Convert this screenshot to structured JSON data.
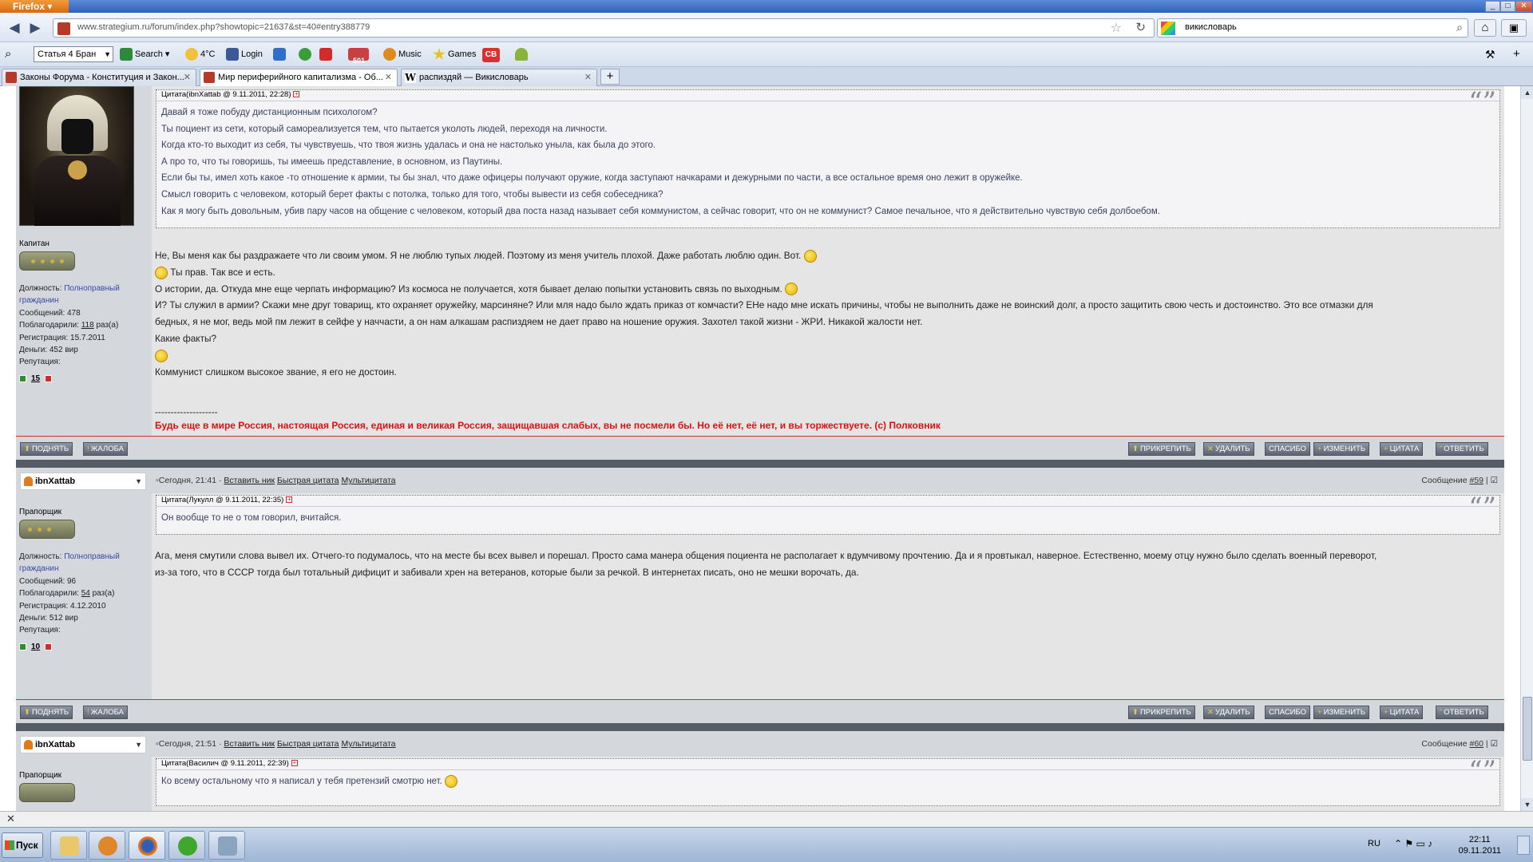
{
  "window": {
    "app_button": "Firefox"
  },
  "nav": {
    "url": "www.strategium.ru/forum/index.php?showtopic=21637&st=40#entry388779",
    "search_value": "викисловарь"
  },
  "toolbar": {
    "select_value": "Статья 4 Бран",
    "search_label": "Search",
    "weather": "4°C",
    "login_label": "Login",
    "badge_count": "501",
    "music_label": "Music",
    "games_label": "Games",
    "cb_label": "CB"
  },
  "tabs": [
    {
      "title": "Законы Форума - Конституция и Закон..."
    },
    {
      "title": "Мир периферийного капитализма - Об..."
    },
    {
      "title": "распиздяй — Викисловарь"
    }
  ],
  "posts": [
    {
      "user": {
        "rank": "Капитан",
        "position_label": "Должность:",
        "position_value": "Полноправный гражданин",
        "messages": "Сообщений: 478",
        "thanks_prefix": "Поблагодарили:",
        "thanks_count": "118",
        "thanks_suffix": "раз(а)",
        "registered": "Регистрация: 15.7.2011",
        "money": "Деньги: 452 вир",
        "rep_label": "Репутация:",
        "rep_value": "15"
      },
      "quote": {
        "title": "Цитата(ibnXattab @ 9.11.2011, 22:28)",
        "lines": [
          "Давай я тоже побуду дистанционным психологом?",
          "Ты поциент из сети, который самореализуется тем, что пытается уколоть людей, переходя на личности.",
          "Когда кто-то выходит из себя, ты чувствуешь, что твоя жизнь удалась и она не настолько уныла, как была до этого.",
          "А про то, что ты говоришь, ты имеешь представление, в основном, из Паутины.",
          "Если бы ты, имел хоть какое -то отношение к армии, ты бы знал, что даже офицеры получают оружие, когда заступают начкарами и дежурными по части, а все остальное время оно лежит в оружейке.",
          "Смысл говорить с человеком, который берет факты с потолка, только для того, чтобы вывести из себя собеседника?",
          "Как я могу быть довольным, убив пару часов на общение с человеком, который два поста назад называет себя коммунистом, а сейчас говорит, что он не коммунист? Самое печальное, что я действительно чувствую себя долбоебом."
        ]
      },
      "text_lines": [
        "Не, Вы меня как бы раздражаете что ли своим умом. Я не люблю тупых людей. Поэтому из меня учитель плохой. Даже работать люблю один. Вот.",
        "Ты прав. Так все и есть.",
        "О истории, да. Откуда мне еще черпать информацию? Из космоса не получается, хотя бывает делаю попытки установить связь по выходным.",
        "И? Ты служил в армии? Скажи мне друг товарищ, кто охраняет оружейку, марсиняне? Или мля надо было ждать приказ от комчасти? ЕНе надо мне искать причины, чтобы не выполнить даже не воинский долг, а просто защитить свою честь и достоинство. Это все отмазки для",
        "бедных, я не мог, ведь мой пм лежит в сейфе у наччасти, а он нам алкашам распиздяем не дает право на ношение оружия. Захотел такой жизни - ЖРИ. Никакой жалости нет.",
        "Какие факты?",
        "Коммунист слишком высокое звание, я его не достоин."
      ],
      "sig_dashes": "--------------------",
      "signature": "Будь еще в мире Россия, настоящая Россия, единая и великая Россия, защищавшая слабых, вы не посмели бы. Но её нет, её нет, и вы торжествуете. (с) Полковник"
    },
    {
      "username": "ibnXattab",
      "meta_time": "Сегодня, 21:41 ·",
      "link_insert": "Вставить ник",
      "link_quick": "Быстрая цитата",
      "link_multi": "Мультицитата",
      "msg_prefix": "Сообщение",
      "msg_num": "#59",
      "user": {
        "rank": "Прапорщик",
        "position_label": "Должность:",
        "position_value": "Полноправный гражданин",
        "messages": "Сообщений: 96",
        "thanks_prefix": "Поблагодарили:",
        "thanks_count": "54",
        "thanks_suffix": "раз(а)",
        "registered": "Регистрация: 4.12.2010",
        "money": "Деньги: 512 вир",
        "rep_label": "Репутация:",
        "rep_value": "10"
      },
      "quote": {
        "title": "Цитата(Лукулл @ 9.11.2011, 22:35)",
        "lines": [
          "Он вообще то не о том говорил, вчитайся."
        ]
      },
      "text_lines": [
        "Ага, меня смутили слова вывел их. Отчего-то подумалось, что на месте бы всех вывел и порешал. Просто сама манера общения поциента не располагает к вдумчивому прочтению. Да и я провтыкал, наверное. Естественно, моему отцу нужно было сделать военный переворот,",
        "из-за того, что в СССР тогда был тотальный дифицит и забивали хрен на ветеранов, которые были за речкой. В интернетах писать, оно не мешки ворочать, да."
      ]
    },
    {
      "username": "ibnXattab",
      "meta_time": "Сегодня, 21:51 ·",
      "link_insert": "Вставить ник",
      "link_quick": "Быстрая цитата",
      "link_multi": "Мультицитата",
      "msg_prefix": "Сообщение",
      "msg_num": "#60",
      "user": {
        "rank": "Прапорщик"
      },
      "quote": {
        "title": "Цитата(Василич @ 9.11.2011, 22:39)",
        "lines": [
          "Ко всему остальному что я написал у тебя претензий смотрю нет."
        ]
      }
    }
  ],
  "footer_buttons": {
    "up": "ПОДНЯТЬ",
    "complaint": "ЖАЛОБА",
    "pin": "ПРИКРЕПИТЬ",
    "delete": "УДАЛИТЬ",
    "thanks": "СПАСИБО",
    "edit": "ИЗМЕНИТЬ",
    "quote": "ЦИТАТА",
    "reply": "ОТВЕТИТЬ"
  },
  "taskbar": {
    "start_label": "Пуск",
    "lang": "RU",
    "time": "22:11",
    "date": "09.11.2011"
  }
}
